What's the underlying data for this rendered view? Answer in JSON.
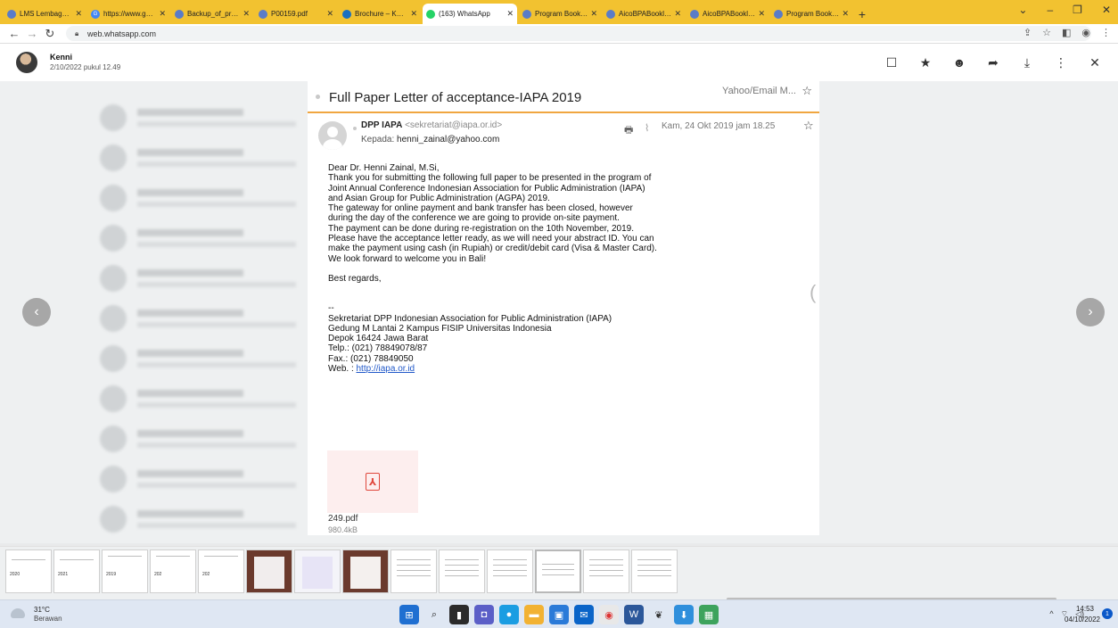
{
  "browser": {
    "tabs": [
      {
        "label": "LMS Lembaga Adv",
        "active": false
      },
      {
        "label": "https://www.goog",
        "active": false
      },
      {
        "label": "Backup_of_prosid",
        "active": false
      },
      {
        "label": "P00159.pdf",
        "active": false
      },
      {
        "label": "Brochure – KONAS",
        "active": false
      },
      {
        "label": "(163) WhatsApp",
        "active": true
      },
      {
        "label": "Program Book 201",
        "active": false
      },
      {
        "label": "AicoBPABooklet20",
        "active": false
      },
      {
        "label": "AicoBPABooklet20",
        "active": false
      },
      {
        "label": "Program Book 201",
        "active": false
      }
    ],
    "new_tab": "+",
    "url": "web.whatsapp.com"
  },
  "viewer": {
    "sender_name": "Kenni",
    "sender_time": "2/10/2022 pukul 12.49"
  },
  "email": {
    "subject": "Full Paper Letter of acceptance-IAPA 2019",
    "folder": "Yahoo/Email M...",
    "from_name": "DPP IAPA",
    "from_email": "<sekretariat@iapa.or.id>",
    "to_label": "Kepada:",
    "to_email": "henni_zainal@yahoo.com",
    "date": "Kam, 24 Okt 2019 jam 18.25",
    "body": {
      "greeting": "Dear Dr. Henni Zainal, M.Si,",
      "p1": "Thank you for submitting the following full paper to be presented in the program of Joint Annual Conference Indonesian Association for Public Administration (IAPA) and Asian Group for Public Administration (AGPA) 2019.",
      "p2": "The gateway for online payment and bank transfer has been closed, however during the day of the conference we are going to provide on-site payment.",
      "p3": "The payment can be done during re-registration on the 10th November, 2019. Please have the acceptance letter ready, as we will need your abstract ID. You can make the payment using cash (in Rupiah) or credit/debit card (Visa & Master Card).",
      "p4": "We look forward to welcome you in Bali!",
      "closing": "Best regards,",
      "sig_dash": "--",
      "sig1": "Sekretariat DPP Indonesian Association for Public Administration (IAPA)",
      "sig2": "Gedung M Lantai 2 Kampus FISIP Universitas Indonesia",
      "sig3": "Depok 16424 Jawa Barat",
      "sig4": "Telp.: (021) 78849078/87",
      "sig5": "Fax.: (021) 78849050",
      "sig_web_label": "Web. :",
      "sig_web_link": "http://iapa.or.id"
    },
    "attachment": {
      "name": "249.pdf",
      "size": "980.4kB"
    }
  },
  "thumbnails": {
    "labels": [
      "2020",
      "2021",
      "2019",
      "202",
      "202"
    ]
  },
  "taskbar": {
    "weather_temp": "31°C",
    "weather_desc": "Berawan",
    "time": "14:53",
    "date": "04/10/2022",
    "notifications": "1"
  },
  "colors": {
    "tabstrip": "#f2c230",
    "accent_rule": "#f0a640",
    "link": "#2159c9",
    "pdf_red": "#e0473c"
  }
}
